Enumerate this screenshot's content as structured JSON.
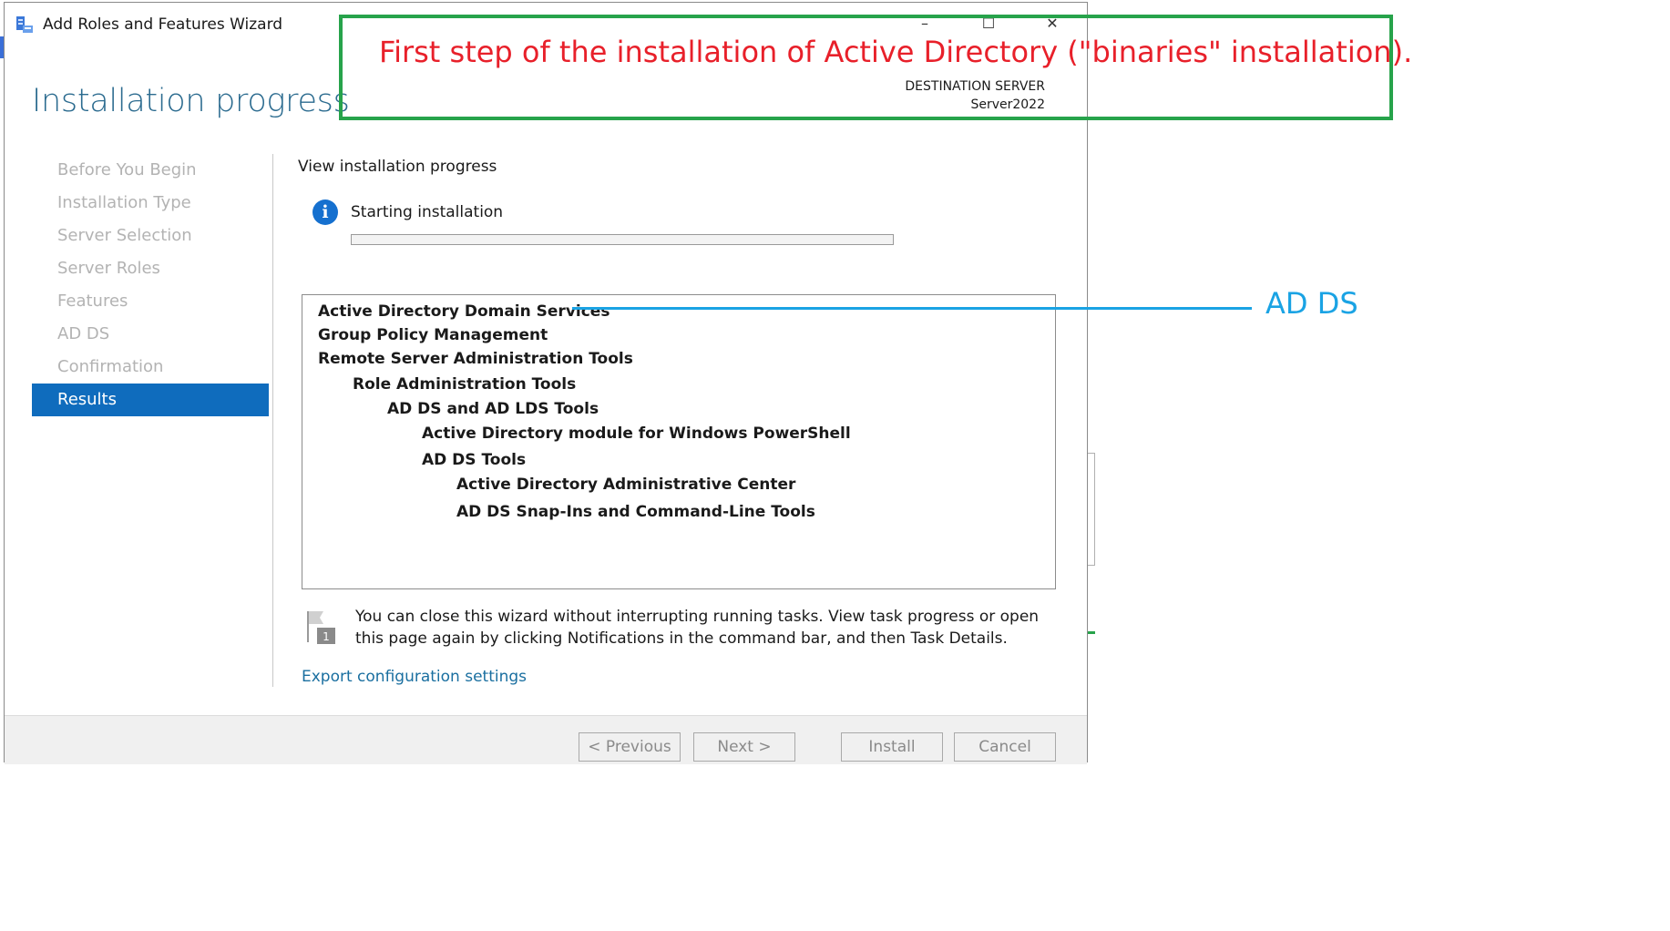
{
  "window": {
    "title": "Add Roles and Features Wizard",
    "controls": {
      "minimize": "–",
      "maximize": "☐",
      "close": "✕"
    }
  },
  "header": {
    "page_title": "Installation progress",
    "destination_label": "DESTINATION SERVER",
    "destination_server": "Server2022"
  },
  "nav": {
    "items": [
      {
        "label": "Before You Begin",
        "active": false
      },
      {
        "label": "Installation Type",
        "active": false
      },
      {
        "label": "Server Selection",
        "active": false
      },
      {
        "label": "Server Roles",
        "active": false
      },
      {
        "label": "Features",
        "active": false
      },
      {
        "label": "AD DS",
        "active": false
      },
      {
        "label": "Confirmation",
        "active": false
      },
      {
        "label": "Results",
        "active": true
      }
    ]
  },
  "main": {
    "heading": "View installation progress",
    "status": "Starting installation",
    "progress_fraction": 0,
    "features": [
      {
        "label": "Active Directory Domain Services",
        "level": 0
      },
      {
        "label": "Group Policy Management",
        "level": 0
      },
      {
        "label": "Remote Server Administration Tools",
        "level": 0
      },
      {
        "label": "Role Administration Tools",
        "level": 1
      },
      {
        "label": "AD DS and AD LDS Tools",
        "level": 2
      },
      {
        "label": "Active Directory module for Windows PowerShell",
        "level": 3
      },
      {
        "label": "AD DS Tools",
        "level": 3
      },
      {
        "label": "Active Directory Administrative Center",
        "level": 4
      },
      {
        "label": "AD DS Snap-Ins and Command-Line Tools",
        "level": 4
      }
    ],
    "notice_badge": "1",
    "notice": "You can close this wizard without interrupting running tasks. View task progress or open this page again by clicking Notifications in the command bar, and then Task Details.",
    "export_link": "Export configuration settings"
  },
  "footer": {
    "previous": "< Previous",
    "next": "Next >",
    "install": "Install",
    "cancel": "Cancel"
  },
  "annotations": {
    "caption": "First step of the installation of Active Directory (\"binaries\" installation).",
    "callout": "AD DS",
    "caption_color": "#e8202a",
    "box_color": "#27a34b",
    "callout_color": "#1aa3e4"
  },
  "colors": {
    "accent": "#0f6cbd",
    "title": "#2b6b8f",
    "link": "#1a6fa0"
  }
}
